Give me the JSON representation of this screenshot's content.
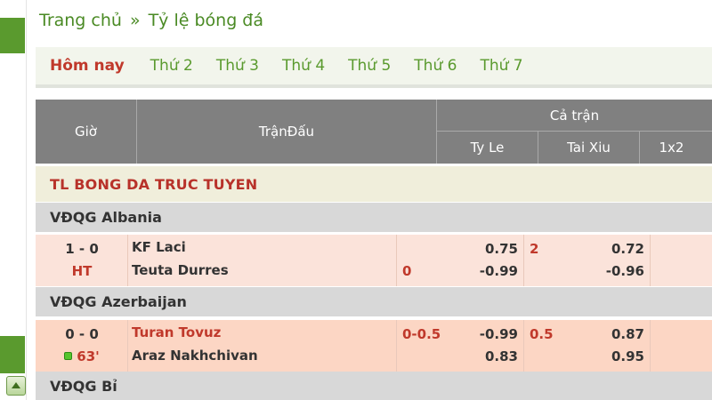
{
  "breadcrumb": {
    "home": "Trang chủ",
    "separator": "»",
    "current": "Tỷ lệ bóng đá"
  },
  "day_tabs": [
    "Hôm nay",
    "Thứ 2",
    "Thứ 3",
    "Thứ 4",
    "Thứ 5",
    "Thứ 6",
    "Thứ 7"
  ],
  "table_header": {
    "time": "Giờ",
    "match": "TrậnĐấu",
    "full_match": "Cả trận",
    "handicap": "Ty Le",
    "over_under": "Tai Xiu",
    "one_x_two": "1x2"
  },
  "section_title": "TL BONG DA TRUC TUYEN",
  "leagues": [
    {
      "name": "VĐQG Albania"
    },
    {
      "name": "VĐQG Azerbaijan"
    },
    {
      "name": "VĐQG Bỉ"
    }
  ],
  "matches": [
    {
      "score": "1 - 0",
      "status": "HT",
      "home": "KF Laci",
      "away": "Teuta Durres",
      "handicap_line": "0",
      "handicap_odds_home": "0.75",
      "handicap_odds_away": "-0.99",
      "ou_line": "2",
      "ou_odds_over": "0.72",
      "ou_odds_under": "-0.96"
    },
    {
      "score": "0 - 0",
      "status": "63'",
      "home": "Turan Tovuz",
      "away": "Araz Nakhchivan",
      "handicap_line": "0-0.5",
      "handicap_odds_home": "-0.99",
      "handicap_odds_away": "0.83",
      "ou_line": "0.5",
      "ou_odds_over": "0.87",
      "ou_odds_under": "0.95"
    }
  ],
  "colors": {
    "brand_green": "#4a8a24",
    "accent_red": "#c0392b",
    "header_grey": "#808080",
    "row_pink": "#fbe3da"
  }
}
